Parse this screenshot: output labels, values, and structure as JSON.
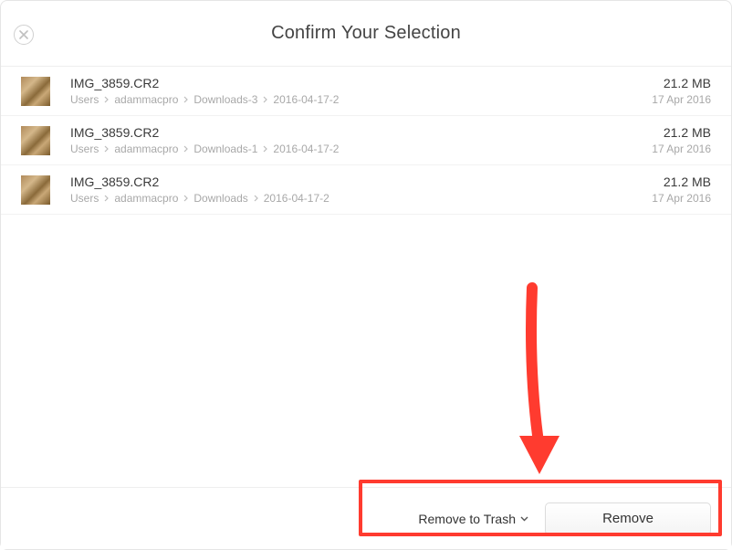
{
  "header": {
    "title": "Confirm Your Selection"
  },
  "files": [
    {
      "name": "IMG_3859.CR2",
      "path": [
        "Users",
        "adammacpro",
        "Downloads-3",
        "2016-04-17-2"
      ],
      "size": "21.2 MB",
      "date": "17 Apr 2016"
    },
    {
      "name": "IMG_3859.CR2",
      "path": [
        "Users",
        "adammacpro",
        "Downloads-1",
        "2016-04-17-2"
      ],
      "size": "21.2 MB",
      "date": "17 Apr 2016"
    },
    {
      "name": "IMG_3859.CR2",
      "path": [
        "Users",
        "adammacpro",
        "Downloads",
        "2016-04-17-2"
      ],
      "size": "21.2 MB",
      "date": "17 Apr 2016"
    }
  ],
  "footer": {
    "dropdown_label": "Remove to Trash",
    "remove_label": "Remove"
  }
}
